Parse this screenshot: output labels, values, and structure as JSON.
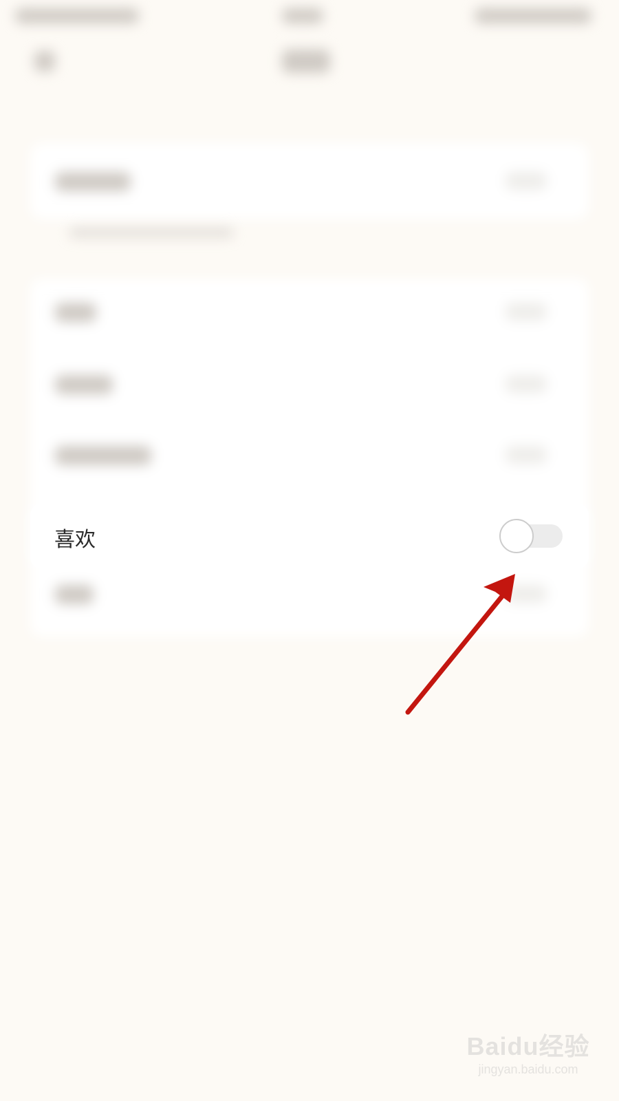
{
  "settings": {
    "row_label": "喜欢",
    "toggle_state": "off"
  },
  "watermark": {
    "main": "Baidu经验",
    "sub": "jingyan.baidu.com"
  },
  "colors": {
    "background": "#fdfaf5",
    "arrow": "#c3160f"
  }
}
